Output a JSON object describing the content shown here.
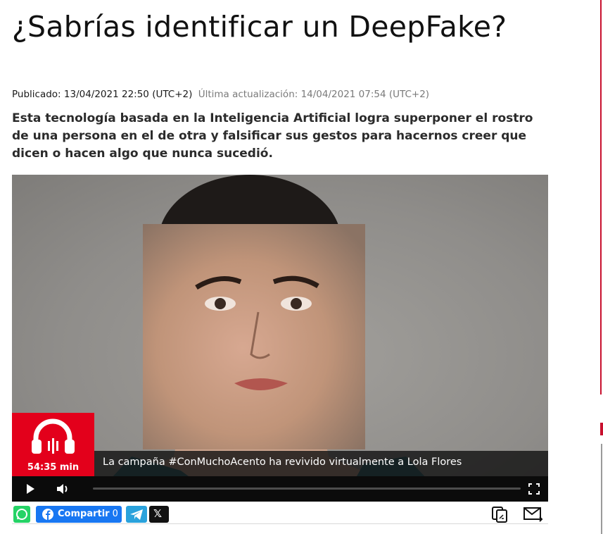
{
  "article": {
    "title": "¿Sabrías identificar un DeepFake?",
    "published": "Publicado: 13/04/2021 22:50 (UTC+2)",
    "updated": "Última actualización: 14/04/2021 07:54 (UTC+2)",
    "lead": "Esta tecnología basada en la Inteligencia Artificial logra superponer el rostro de una persona en el de otra y falsificar sus gestos para hacernos creer que dicen o hacen algo que nunca sucedió."
  },
  "player": {
    "duration_badge": "54:35 min",
    "caption": "La campaña #ConMuchoAcento ha revivido virtualmente a Lola Flores",
    "progress": 0
  },
  "share": {
    "facebook_label": "Compartir",
    "facebook_count": "0",
    "x_label": "𝕏"
  },
  "colors": {
    "brand_red": "#e3001b",
    "facebook": "#1877f2",
    "whatsapp": "#25d366",
    "telegram": "#2aa2dc"
  }
}
